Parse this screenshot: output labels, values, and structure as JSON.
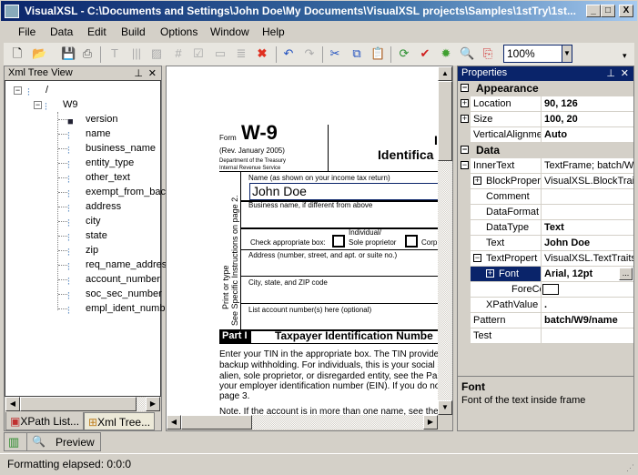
{
  "window": {
    "title": "VisualXSL - C:\\Documents and Settings\\John Doe\\My Documents\\VisualXSL projects\\Samples\\1stTry\\1st...",
    "controls": [
      "_",
      "□",
      "X"
    ]
  },
  "menu": [
    "File",
    "Data",
    "Edit",
    "Build",
    "Options",
    "Window",
    "Help"
  ],
  "toolbar": {
    "icons": [
      "new-icon",
      "open-icon",
      "save-icon",
      "print-icon",
      "text-frame-icon",
      "barcode-icon",
      "image-icon",
      "number-icon",
      "checkbox-icon",
      "field-icon",
      "textblock-icon",
      "delete-icon",
      "undo-icon",
      "redo-icon",
      "cut-icon",
      "copy-icon",
      "paste-icon",
      "refresh-icon",
      "validate-icon",
      "build-icon",
      "preview-icon",
      "pdf-icon"
    ],
    "zoom": "100%"
  },
  "left_panel": {
    "title": "Xml Tree View",
    "root": "/",
    "w9": "W9",
    "nodes": [
      "version",
      "name",
      "business_name",
      "entity_type",
      "other_text",
      "exempt_from_back",
      "address",
      "city",
      "state",
      "zip",
      "req_name_address",
      "account_number",
      "soc_sec_number",
      "empl_ident_numbe"
    ],
    "tabs": [
      "XPath List...",
      "Xml Tree..."
    ]
  },
  "document": {
    "form": "Form",
    "form_no": "W-9",
    "rev": "(Rev. January 2005)",
    "dept": "Department of the Treasury",
    "irs": "Internal Revenue Service",
    "heading": "Identifica",
    "heading_top": "I",
    "side1": "Print or type",
    "side2": "See Specific Instructions on page 2.",
    "name_label": "Name (as shown on your income tax return)",
    "name_value": "John Doe",
    "business_label": "Business name, if different from above",
    "check_label": "Check appropriate box:",
    "individual": "Individual/",
    "sole": "Sole proprietor",
    "corp": "Corp",
    "address_label": "Address (number, street, and apt. or suite no.)",
    "city_label": "City, state, and ZIP code",
    "account_label": "List account number(s) here (optional)",
    "part": "Part I",
    "part_title": "Taxpayer Identification Numbe",
    "body": [
      "Enter your TIN in the appropriate box. The TIN provided",
      "backup withholding. For individuals, this is your social s",
      "alien, sole proprietor, or disregarded entity, see the Par",
      "your employer identification number (EIN). If you do no",
      "page 3."
    ],
    "note": "Note. If the account is in more than one name, see the"
  },
  "properties": {
    "title": "Properties",
    "rows": [
      {
        "cat": true,
        "name": "Appearance",
        "sign": "−"
      },
      {
        "name": "Location",
        "value": "90, 126",
        "bold": true,
        "sign": "+",
        "indent": 0
      },
      {
        "name": "Size",
        "value": "100, 20",
        "bold": true,
        "sign": "+",
        "indent": 0
      },
      {
        "name": "VerticalAlignme",
        "value": "Auto",
        "bold": true,
        "indent": 0
      },
      {
        "cat": true,
        "name": "Data",
        "sign": "−"
      },
      {
        "name": "InnerText",
        "value": "TextFrame; batch/W9",
        "sign": "−",
        "indent": 0
      },
      {
        "name": "BlockProper",
        "value": "VisualXSL.BlockTraits",
        "sign": "+",
        "indent": 1
      },
      {
        "name": "Comment",
        "value": "",
        "indent": 1
      },
      {
        "name": "DataFormat",
        "value": "",
        "indent": 1
      },
      {
        "name": "DataType",
        "value": "Text",
        "bold": true,
        "indent": 1
      },
      {
        "name": "Text",
        "value": "John Doe",
        "bold": true,
        "indent": 1
      },
      {
        "name": "TextPropert",
        "value": "VisualXSL.TextTraits",
        "sign": "−",
        "indent": 1
      },
      {
        "name": "Font",
        "value": "Arial, 12pt",
        "bold": true,
        "sign": "+",
        "indent": 2,
        "selected": true
      },
      {
        "name": "ForeColo",
        "value": "",
        "indent": 3,
        "swatch": "#ffffff"
      },
      {
        "name": "XPathValue",
        "value": ".",
        "bold": true,
        "indent": 1
      },
      {
        "name": "Pattern",
        "value": "batch/W9/name",
        "bold": true,
        "indent": 0
      },
      {
        "name": "Test",
        "value": "",
        "indent": 0
      }
    ],
    "desc_title": "Font",
    "desc_text": "Font of the text inside frame"
  },
  "bottom_tabs": [
    "Preview"
  ],
  "status": "Formatting elapsed: 0:0:0",
  "colors": {
    "title_bar": "#0a246a",
    "panel_header": "#0a246a",
    "selection": "#0a246a"
  }
}
